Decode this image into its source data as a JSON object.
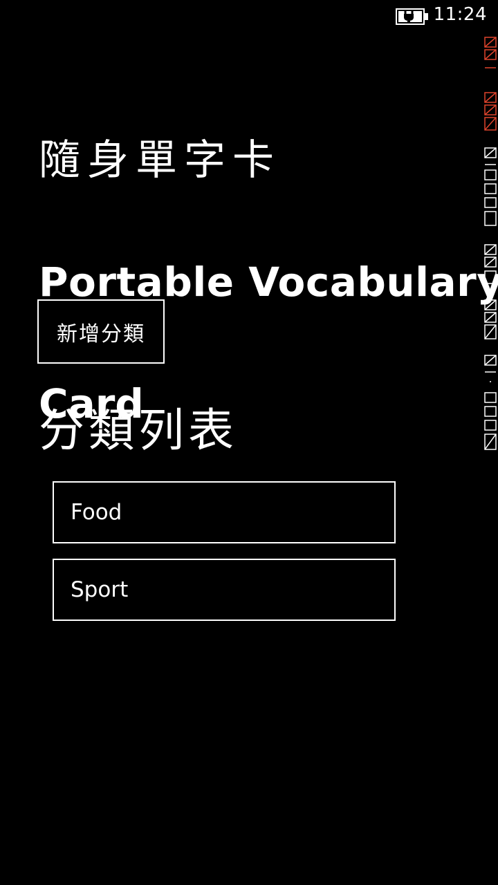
{
  "status_bar": {
    "time": "11:24",
    "battery_icon": "battery-charging-icon"
  },
  "header": {
    "title_zh": "隨身單字卡",
    "title_en_line1": "Portable Vocabulary",
    "title_en_line2": "Card"
  },
  "toolbar": {
    "add_category_label": "新增分類"
  },
  "categories": {
    "heading": "分類列表",
    "items": [
      {
        "label": "Food"
      },
      {
        "label": "Sport"
      }
    ]
  },
  "colors": {
    "background": "#000000",
    "foreground": "#ffffff",
    "debug_red": "#e0442c"
  }
}
